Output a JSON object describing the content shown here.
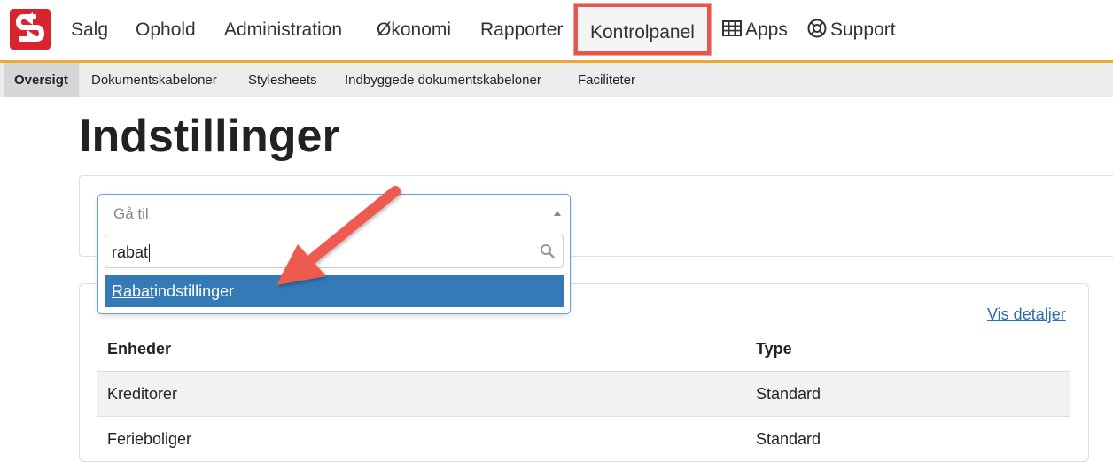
{
  "nav": {
    "items": [
      {
        "label": "Salg"
      },
      {
        "label": "Ophold"
      },
      {
        "label": "Administration"
      },
      {
        "label": "Økonomi"
      },
      {
        "label": "Rapporter"
      },
      {
        "label": "Kontrolpanel"
      },
      {
        "label": "Apps"
      },
      {
        "label": "Support"
      }
    ]
  },
  "subnav": {
    "items": [
      {
        "label": "Oversigt"
      },
      {
        "label": "Dokumentskabeloner"
      },
      {
        "label": "Stylesheets"
      },
      {
        "label": "Indbyggede dokumentskabeloner"
      },
      {
        "label": "Faciliteter"
      }
    ]
  },
  "page": {
    "title": "Indstillinger"
  },
  "goto": {
    "placeholder": "Gå til",
    "search_value": "rabat",
    "option_match": "Rabat",
    "option_rest": "indstillinger"
  },
  "table": {
    "link": "Vis detaljer",
    "headers": [
      "Enheder",
      "Type"
    ],
    "rows": [
      [
        "Kreditorer",
        "Standard"
      ],
      [
        "Ferieboliger",
        "Standard"
      ]
    ]
  },
  "colors": {
    "accent": "#f0a830",
    "brand": "#d9232d",
    "highlight": "#e8554e",
    "selected": "#337ab7",
    "link": "#2a6fb0"
  }
}
